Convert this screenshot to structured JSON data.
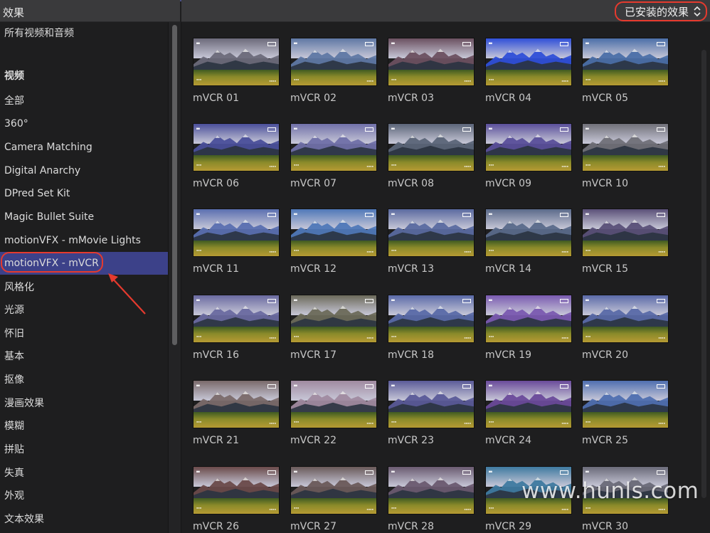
{
  "sidebar": {
    "title": "效果",
    "items": [
      {
        "label": "所有视频和音频",
        "type": "item"
      },
      {
        "label": "视频",
        "type": "heading"
      },
      {
        "label": "全部",
        "type": "item"
      },
      {
        "label": "360°",
        "type": "item"
      },
      {
        "label": "Camera Matching",
        "type": "item"
      },
      {
        "label": "Digital Anarchy",
        "type": "item"
      },
      {
        "label": "DPred Set Kit",
        "type": "item"
      },
      {
        "label": "Magic Bullet Suite",
        "type": "item"
      },
      {
        "label": "motionVFX - mMovie Lights",
        "type": "item"
      },
      {
        "label": "motionVFX - mVCR",
        "type": "selected"
      },
      {
        "label": "风格化",
        "type": "item"
      },
      {
        "label": "光源",
        "type": "item"
      },
      {
        "label": "怀旧",
        "type": "item"
      },
      {
        "label": "基本",
        "type": "item"
      },
      {
        "label": "抠像",
        "type": "item"
      },
      {
        "label": "漫画效果",
        "type": "item"
      },
      {
        "label": "模糊",
        "type": "item"
      },
      {
        "label": "拼贴",
        "type": "item"
      },
      {
        "label": "失真",
        "type": "item"
      },
      {
        "label": "外观",
        "type": "item"
      },
      {
        "label": "文本效果",
        "type": "item"
      }
    ]
  },
  "header": {
    "filter_label": "已安装的效果"
  },
  "effects": [
    {
      "label": "mVCR 01",
      "tint": "#6c6a7a"
    },
    {
      "label": "mVCR 02",
      "tint": "#5f78a4"
    },
    {
      "label": "mVCR 03",
      "tint": "#6b5060"
    },
    {
      "label": "mVCR 04",
      "tint": "#2f4fd8"
    },
    {
      "label": "mVCR 05",
      "tint": "#4b6fa8"
    },
    {
      "label": "mVCR 06",
      "tint": "#4a4f9a"
    },
    {
      "label": "mVCR 07",
      "tint": "#7070a8"
    },
    {
      "label": "mVCR 08",
      "tint": "#5b6578"
    },
    {
      "label": "mVCR 09",
      "tint": "#5a4f9a"
    },
    {
      "label": "mVCR 10",
      "tint": "#707078"
    },
    {
      "label": "mVCR 11",
      "tint": "#5a6fb0"
    },
    {
      "label": "mVCR 12",
      "tint": "#4f78b8"
    },
    {
      "label": "mVCR 13",
      "tint": "#5a6aa0"
    },
    {
      "label": "mVCR 14",
      "tint": "#5a6a8a"
    },
    {
      "label": "mVCR 15",
      "tint": "#5a5078"
    },
    {
      "label": "mVCR 16",
      "tint": "#6a6aa0"
    },
    {
      "label": "mVCR 17",
      "tint": "#6c6a5a"
    },
    {
      "label": "mVCR 18",
      "tint": "#5a6aa8"
    },
    {
      "label": "mVCR 19",
      "tint": "#7a5ab0"
    },
    {
      "label": "mVCR 20",
      "tint": "#5a6aa8"
    },
    {
      "label": "mVCR 21",
      "tint": "#7a6a6a"
    },
    {
      "label": "mVCR 22",
      "tint": "#a08aa0"
    },
    {
      "label": "mVCR 23",
      "tint": "#5a5a98"
    },
    {
      "label": "mVCR 24",
      "tint": "#6a4a9a"
    },
    {
      "label": "mVCR 25",
      "tint": "#4f6fb0"
    },
    {
      "label": "mVCR 26",
      "tint": "#6a4a4a"
    },
    {
      "label": "mVCR 27",
      "tint": "#6a5a5a"
    },
    {
      "label": "mVCR 28",
      "tint": "#6a5a70"
    },
    {
      "label": "mVCR 29",
      "tint": "#3f7aa0"
    },
    {
      "label": "mVCR 30",
      "tint": "#6a6a78"
    }
  ],
  "watermark": "www.hunls.com",
  "colors": {
    "selection": "#3c4189",
    "highlight_ring": "#e53a2e"
  }
}
